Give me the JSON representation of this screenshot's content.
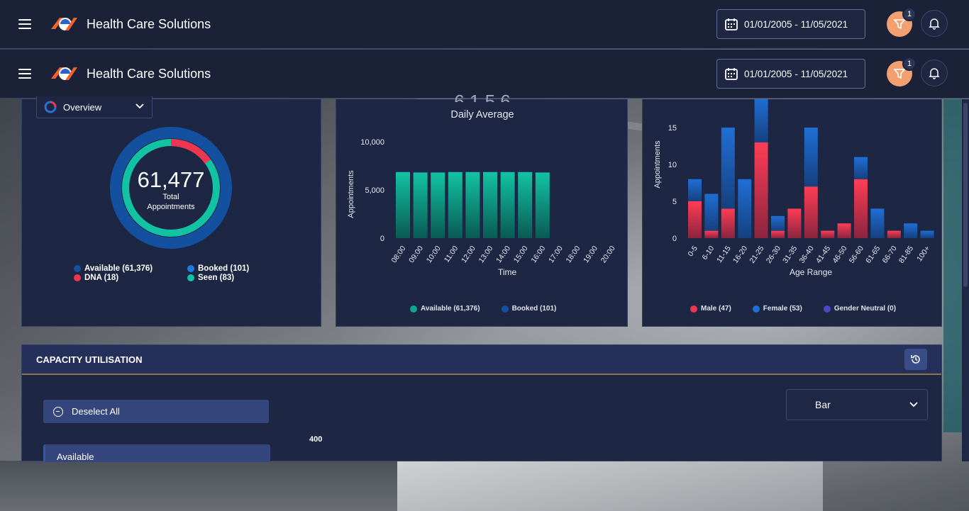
{
  "app": {
    "title": "Health Care Solutions"
  },
  "header": {
    "date_range": "01/01/2005 - 11/05/2021",
    "filter_badge": "1"
  },
  "overview": {
    "select_label": "Overview",
    "total": "61,477",
    "total_label_line1": "Total",
    "total_label_line2": "Appointments",
    "legend": [
      {
        "label": "Available (61,376)",
        "color": "#1351a0"
      },
      {
        "label": "Booked (101)",
        "color": "#1f7be0"
      },
      {
        "label": "DNA (18)",
        "color": "#ef3650"
      },
      {
        "label": "Seen (83)",
        "color": "#12c3a3"
      }
    ]
  },
  "daily": {
    "faded_heading": "6,1 5 6",
    "title": "Daily Average",
    "chart_data": {
      "type": "bar",
      "categories": [
        "08:00",
        "09:00",
        "10:00",
        "11:00",
        "12:00",
        "13:00",
        "14:00",
        "15:00",
        "16:00",
        "17:00",
        "18:00",
        "19:00",
        "20:00"
      ],
      "series": [
        {
          "name": "Available (61,376)",
          "values": [
            6850,
            6800,
            6800,
            6850,
            6850,
            6850,
            6850,
            6850,
            6800,
            0,
            0,
            0,
            0
          ]
        },
        {
          "name": "Booked (101)",
          "values": [
            12,
            11,
            11,
            11,
            12,
            11,
            11,
            11,
            11,
            0,
            0,
            0,
            0
          ]
        }
      ],
      "xlabel": "Time",
      "ylabel": "Appointments",
      "yticks": [
        "0",
        "5,000",
        "10,000"
      ],
      "ylim": [
        0,
        10000
      ]
    },
    "colors": {
      "available_top": "#12c3a3",
      "available_bottom": "#0a5a55",
      "booked": "#1351a0"
    }
  },
  "age": {
    "chart_data": {
      "type": "bar",
      "stacked": true,
      "categories": [
        "0-5",
        "6-10",
        "11-15",
        "16-20",
        "21-25",
        "26-30",
        "31-35",
        "36-40",
        "41-45",
        "46-50",
        "56-60",
        "61-65",
        "66-70",
        "81-85",
        "100+"
      ],
      "series": [
        {
          "name": "Male (47)",
          "values": [
            5,
            1,
            4,
            0,
            13,
            1,
            4,
            7,
            1,
            2,
            8,
            0,
            1,
            0,
            0
          ]
        },
        {
          "name": "Female (53)",
          "values": [
            3,
            5,
            11,
            8,
            6,
            2,
            0,
            8,
            0,
            0,
            3,
            4,
            0,
            2,
            1
          ]
        },
        {
          "name": "Gender Neutral (0)",
          "values": [
            0,
            0,
            0,
            0,
            0,
            0,
            0,
            0,
            0,
            0,
            0,
            0,
            0,
            0,
            0
          ]
        }
      ],
      "xlabel": "Age Range",
      "ylabel": "Appointments",
      "yticks": [
        "0",
        "5",
        "10",
        "15"
      ],
      "ylim": [
        0,
        17
      ]
    },
    "colors": {
      "male": "#ef3650",
      "female": "#1f6fd6",
      "neutral": "#4a48c8"
    }
  },
  "capacity": {
    "title": "CAPACITY UTILISATION",
    "deselect_label": "Deselect All",
    "chart_type": "Bar",
    "y_top_label": "400",
    "first_item": "Available"
  }
}
